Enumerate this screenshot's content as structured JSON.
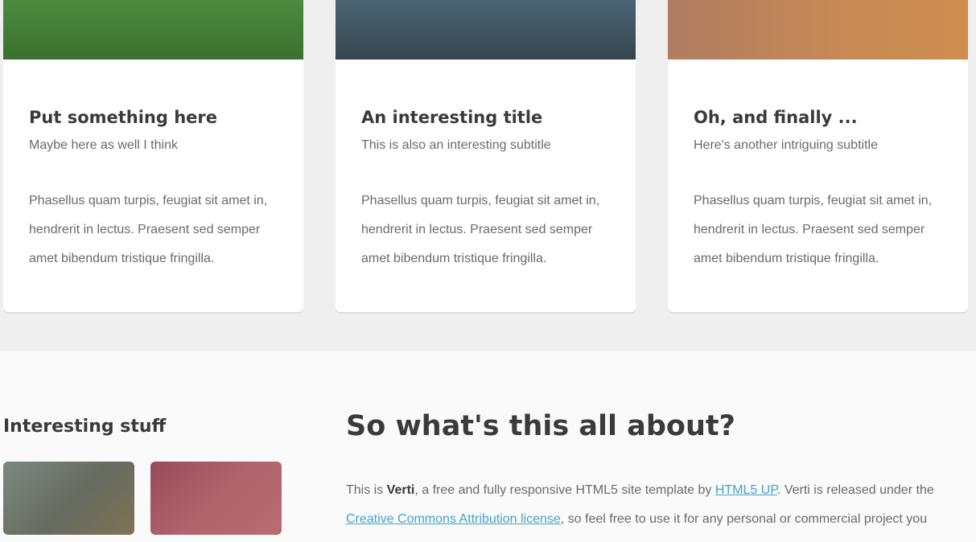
{
  "cards": [
    {
      "title": "Put something here",
      "subtitle": "Maybe here as well I think",
      "body": "Phasellus quam turpis, feugiat sit amet in, hendrerit in lectus. Praesent sed semper amet bibendum tristique fringilla.",
      "image_color": "#3f7a34"
    },
    {
      "title": "An interesting title",
      "subtitle": "This is also an interesting subtitle",
      "body": "Phasellus quam turpis, feugiat sit amet in, hendrerit in lectus. Praesent sed semper amet bibendum tristique fringilla.",
      "image_color": "#3e5260"
    },
    {
      "title": "Oh, and finally ...",
      "subtitle": "Here's another intriguing subtitle",
      "body": "Phasellus quam turpis, feugiat sit amet in, hendrerit in lectus. Praesent sed semper amet bibendum tristique fringilla.",
      "image_color": "#be8650"
    }
  ],
  "sidebar": {
    "heading": "Interesting stuff",
    "thumbnails": [
      {
        "color": "#6f7466"
      },
      {
        "color": "#a75c67"
      }
    ]
  },
  "main": {
    "heading": "So what's this all about?",
    "about": {
      "intro": "This is ",
      "name": "Verti",
      "text1": ", a free and fully responsive HTML5 site template by ",
      "link1": "HTML5 UP",
      "text2": ". Verti is released under the ",
      "link2": "Creative Commons Attribution license",
      "text3": ", so feel free to use it for any personal or commercial project you"
    }
  },
  "colors": {
    "link": "#43a2ca",
    "heading": "#3a3a3a",
    "text": "#6a6a6a"
  }
}
